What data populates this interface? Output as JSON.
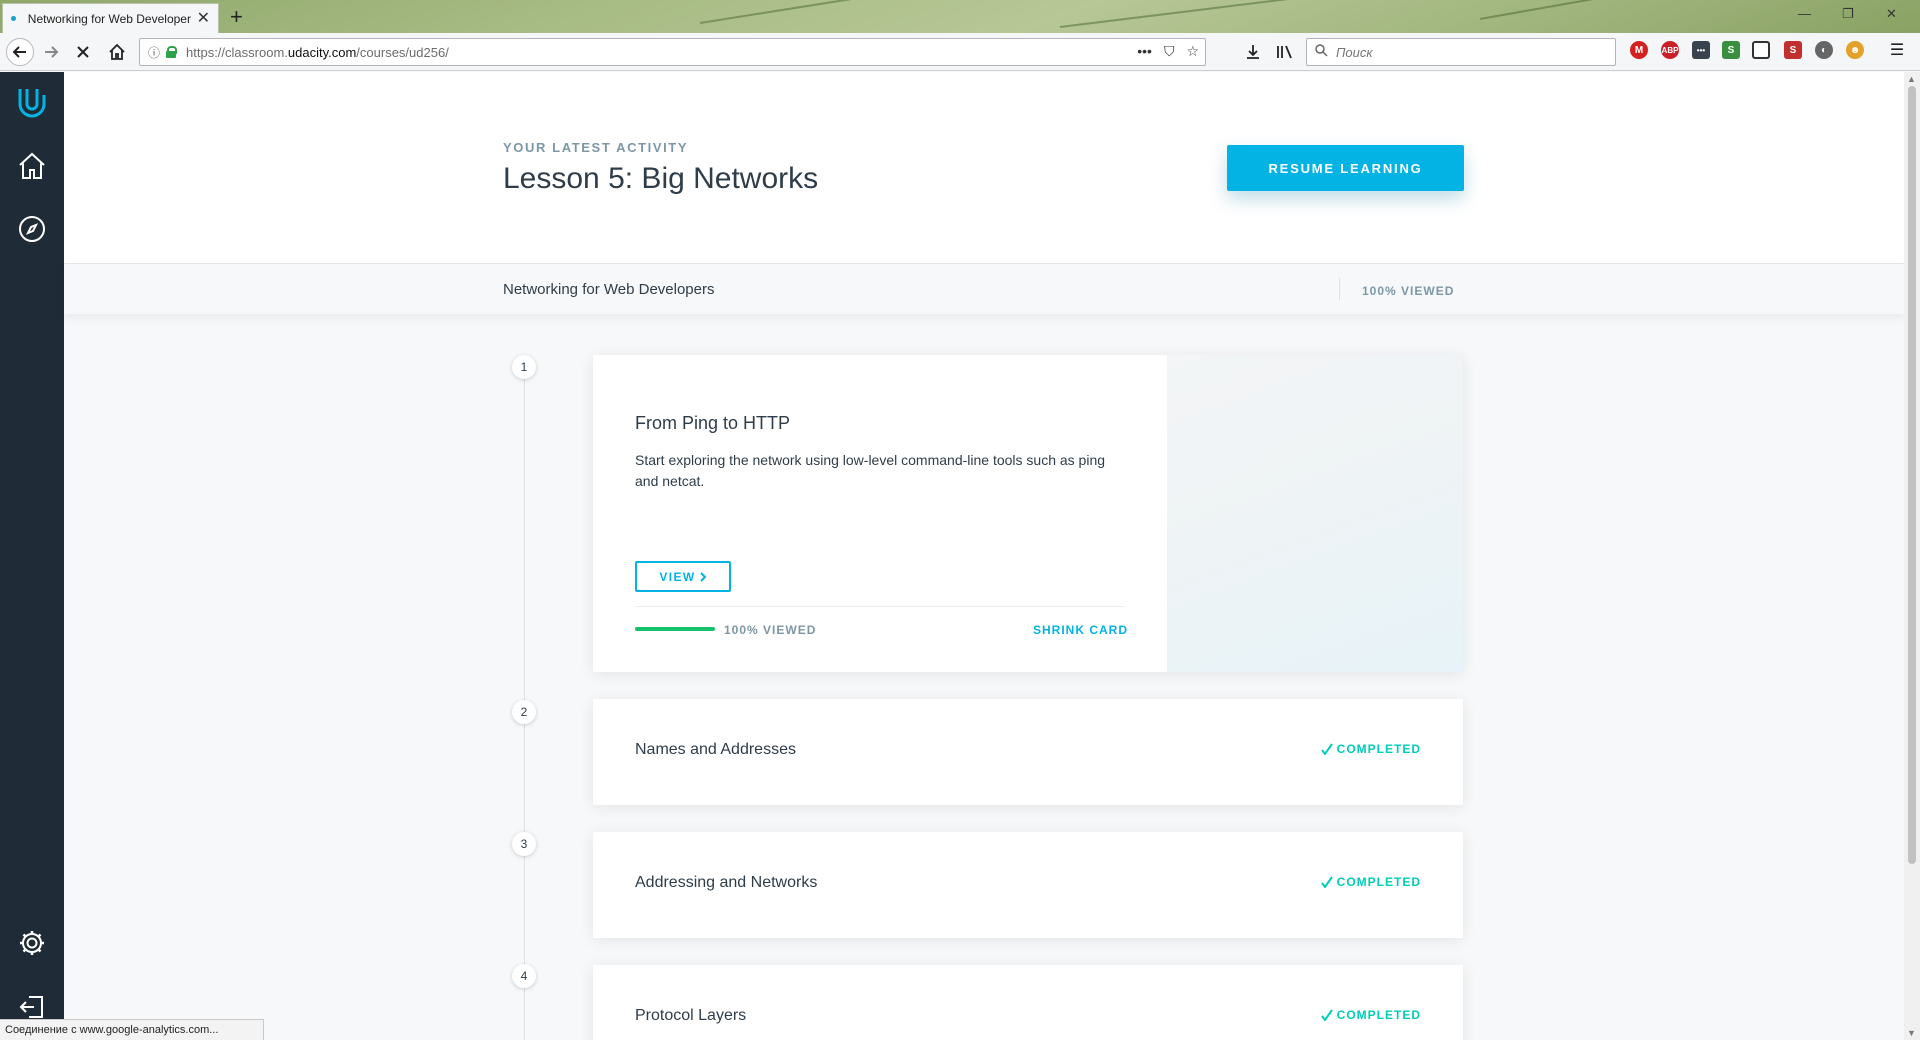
{
  "browser": {
    "tab_title": "Networking for Web Developers",
    "new_tab_label": "+",
    "url_prefix": "https://classroom.",
    "url_domain": "udacity.com",
    "url_path": "/courses/ud256/",
    "search_placeholder": "Поиск",
    "status_text": "Соединение с www.google-analytics.com..."
  },
  "header": {
    "eyebrow": "YOUR LATEST ACTIVITY",
    "lesson_title": "Lesson 5: Big Networks",
    "resume_label": "RESUME LEARNING"
  },
  "course": {
    "name": "Networking for Web Developers",
    "progress": "100% VIEWED"
  },
  "lessons": [
    {
      "number": "1",
      "title": "From Ping to HTTP",
      "description": "Start exploring the network using low-level command-line tools such as ping and netcat.",
      "view_label": "VIEW",
      "progress_fraction": 1.0,
      "progress_label": "100% VIEWED",
      "shrink_label": "SHRINK CARD"
    },
    {
      "number": "2",
      "title": "Names and Addresses",
      "status": "COMPLETED"
    },
    {
      "number": "3",
      "title": "Addressing and Networks",
      "status": "COMPLETED"
    },
    {
      "number": "4",
      "title": "Protocol Layers",
      "status": "COMPLETED"
    }
  ],
  "colors": {
    "accent": "#02b3e4",
    "sidebar": "#1f2b36",
    "progress": "#15c26b",
    "completed": "#02ccba"
  },
  "icons": {
    "sidebar": [
      "udacity-logo-icon",
      "home-icon",
      "compass-icon",
      "settings-icon",
      "logout-icon"
    ]
  }
}
